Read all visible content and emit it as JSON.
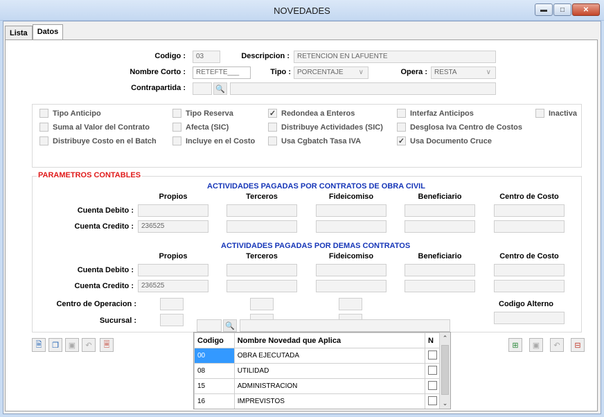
{
  "window": {
    "title": "NOVEDADES"
  },
  "tabs": [
    {
      "label": "Lista"
    },
    {
      "label": "Datos"
    }
  ],
  "header": {
    "codigo_label": "Codigo :",
    "codigo_value": "03",
    "descripcion_label": "Descripcion :",
    "descripcion_value": "RETENCION  EN LAFUENTE",
    "nombre_corto_label": "Nombre Corto :",
    "nombre_corto_value": "RETEFTE___",
    "tipo_label": "Tipo :",
    "tipo_value": "PORCENTAJE",
    "opera_label": "Opera :",
    "opera_value": "RESTA",
    "contrapartida_label": "Contrapartida :"
  },
  "checks": [
    {
      "label": "Tipo Anticipo",
      "checked": false
    },
    {
      "label": "Tipo Reserva",
      "checked": false
    },
    {
      "label": "Redondea a Enteros",
      "checked": true
    },
    {
      "label": "Interfaz Anticipos",
      "checked": false
    },
    {
      "label": "Inactiva",
      "checked": false
    },
    {
      "label": "Suma al Valor del Contrato",
      "checked": false
    },
    {
      "label": "Afecta (SIC)",
      "checked": false
    },
    {
      "label": "Distribuye Actividades (SIC)",
      "checked": false
    },
    {
      "label": "Desglosa Iva Centro de Costos",
      "checked": false
    },
    {
      "label": "Distribuye Costo en el Batch",
      "checked": false
    },
    {
      "label": "Incluye en el Costo",
      "checked": false
    },
    {
      "label": "Usa Cgbatch Tasa IVA",
      "checked": false
    },
    {
      "label": "Usa Documento Cruce",
      "checked": true
    }
  ],
  "params": {
    "legend": "PARAMETROS CONTABLES",
    "section1": "ACTIVIDADES PAGADAS POR CONTRATOS DE OBRA CIVIL",
    "section2": "ACTIVIDADES PAGADAS POR DEMAS CONTRATOS",
    "columns": [
      "Propios",
      "Terceros",
      "Fideicomiso",
      "Beneficiario",
      "Centro de Costo"
    ],
    "cuenta_debito_label": "Cuenta Debito :",
    "cuenta_credito_label": "Cuenta Credito :",
    "credito1_propios": "236525",
    "credito2_propios": "236525",
    "centro_operacion_label": "Centro de Operacion :",
    "sucursal_label": "Sucursal :",
    "codigo_alterno_label": "Codigo Alterno"
  },
  "grid": {
    "headers": [
      "Codigo",
      "Nombre Novedad que Aplica",
      "N"
    ],
    "rows": [
      {
        "codigo": "00",
        "nombre": "OBRA EJECUTADA"
      },
      {
        "codigo": "08",
        "nombre": "UTILIDAD"
      },
      {
        "codigo": "15",
        "nombre": "ADMINISTRACION"
      },
      {
        "codigo": "16",
        "nombre": "IMPREVISTOS"
      }
    ]
  }
}
